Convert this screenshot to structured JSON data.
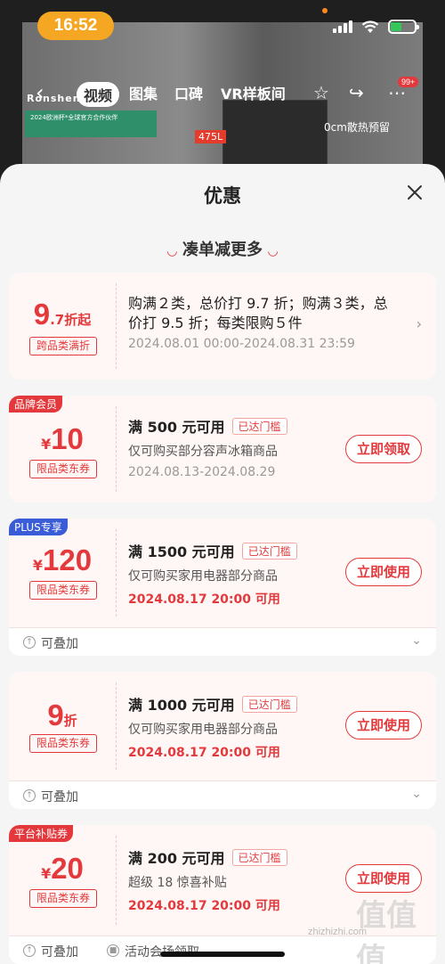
{
  "status_bar": {
    "time": "16:52"
  },
  "background": {
    "brand": "Ronshen",
    "capacity_label": "475L",
    "heat_label": "0cm散热预留",
    "banner_text": "2024欧洲杯*全球官方合作伙伴"
  },
  "top_nav": {
    "tabs": [
      {
        "label": "视频",
        "active": true
      },
      {
        "label": "图集",
        "active": false
      },
      {
        "label": "口碑",
        "active": false
      },
      {
        "label": "VR样板间",
        "active": false
      }
    ],
    "badge": "99+"
  },
  "sheet": {
    "title": "优惠",
    "section_title": "凑单减更多"
  },
  "discount_card": {
    "amount_big": "9",
    "amount_small": ".7折起",
    "tag": "跨品类满折",
    "desc": "购满２类，总价打 9.7 折；购满３类，总价打 9.5 折；每类限购５件",
    "date": "2024.08.01 00:00-2024.08.31 23:59"
  },
  "coupons": [
    {
      "corner": "品牌会员",
      "corner_color": "#e4393c",
      "currency": "¥",
      "amount": "10",
      "suffix": "",
      "type": "限品类东券",
      "condition": "满 500 元可用",
      "reach": "已达门槛",
      "desc": "仅可购买部分容声冰箱商品",
      "date": "2024.08.13-2024.08.29",
      "date_red": false,
      "button": "立即领取",
      "stack": ""
    },
    {
      "corner": "PLUS专享",
      "corner_color": "#3a5cd6",
      "currency": "¥",
      "amount": "120",
      "suffix": "",
      "type": "限品类东券",
      "condition": "满 1500 元可用",
      "reach": "已达门槛",
      "desc": "仅可购买家用电器部分商品",
      "date": "2024.08.17 20:00 可用",
      "date_red": true,
      "button": "立即使用",
      "stack": "可叠加"
    },
    {
      "corner": "",
      "corner_color": "",
      "currency": "",
      "amount": "9",
      "suffix": "折",
      "type": "限品类东券",
      "condition": "满 1000 元可用",
      "reach": "已达门槛",
      "desc": "仅可购买家用电器部分商品",
      "date": "2024.08.17 20:00 可用",
      "date_red": true,
      "button": "立即使用",
      "stack": "可叠加"
    },
    {
      "corner": "平台补贴券",
      "corner_color": "#e4393c",
      "currency": "¥",
      "amount": "20",
      "suffix": "",
      "type": "限品类东券",
      "condition": "满 200 元可用",
      "reach": "已达门槛",
      "desc": "超级 18 惊喜补贴",
      "date": "2024.08.17 20:00 可用",
      "date_red": true,
      "button": "立即使用",
      "stack": "可叠加",
      "extra": "活动会场领取"
    }
  ],
  "watermark": "zhizhizhi.com",
  "watermark_logo": "值值值"
}
